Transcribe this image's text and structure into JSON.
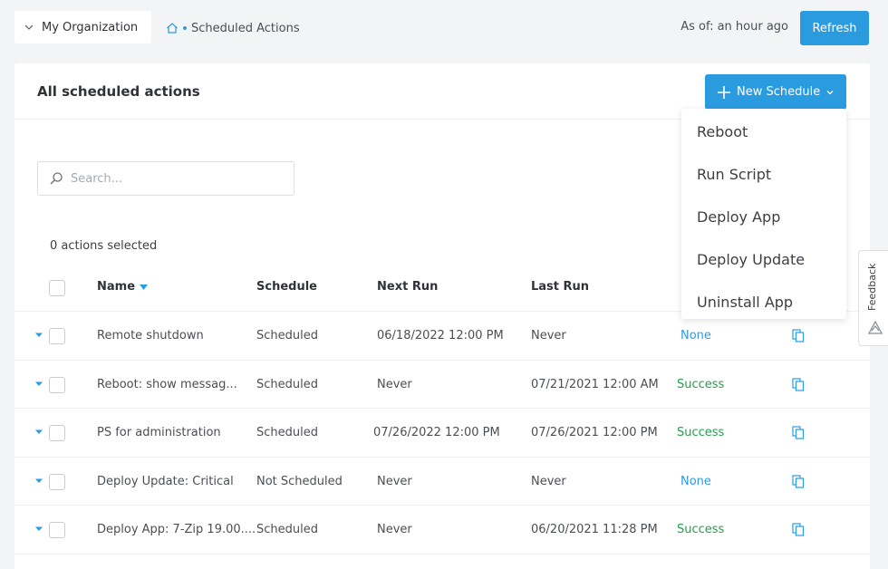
{
  "topbar": {
    "org_label": "My Organization",
    "breadcrumb_label": "Scheduled Actions",
    "as_of": "As of: an hour ago",
    "refresh_label": "Refresh"
  },
  "card": {
    "title": "All scheduled actions",
    "new_schedule_label": "New Schedule",
    "search_placeholder": "Search...",
    "selected_count": "0 actions selected"
  },
  "table": {
    "headers": {
      "name": "Name",
      "schedule": "Schedule",
      "next_run": "Next Run",
      "last_run": "Last Run"
    },
    "rows": [
      {
        "name": "Remote shutdown",
        "schedule": "Scheduled",
        "next_run": "06/18/2022 12:00 PM",
        "last_run": "Never",
        "status": "None"
      },
      {
        "name": "Reboot: show messag...",
        "schedule": "Scheduled",
        "next_run": "Never",
        "last_run": "07/21/2021 12:00 AM",
        "status": "Success"
      },
      {
        "name": "PS for administration",
        "schedule": "Scheduled",
        "next_run": "07/26/2022 12:00 PM",
        "last_run": "07/26/2021 12:00 PM",
        "status": "Success"
      },
      {
        "name": "Deploy Update: Critical",
        "schedule": "Not Scheduled",
        "next_run": "Never",
        "last_run": "Never",
        "status": "None"
      },
      {
        "name": "Deploy App: 7-Zip 19.00....",
        "schedule": "Scheduled",
        "next_run": "Never",
        "last_run": "06/20/2021 11:28 PM",
        "status": "Success"
      }
    ]
  },
  "dropdown": {
    "items": [
      "Reboot",
      "Run Script",
      "Deploy App",
      "Deploy Update",
      "Uninstall App"
    ]
  },
  "feedback": {
    "label": "Feedback"
  },
  "colors": {
    "accent": "#2b9be0",
    "success": "#22a14a",
    "background": "#f3f4f6"
  }
}
